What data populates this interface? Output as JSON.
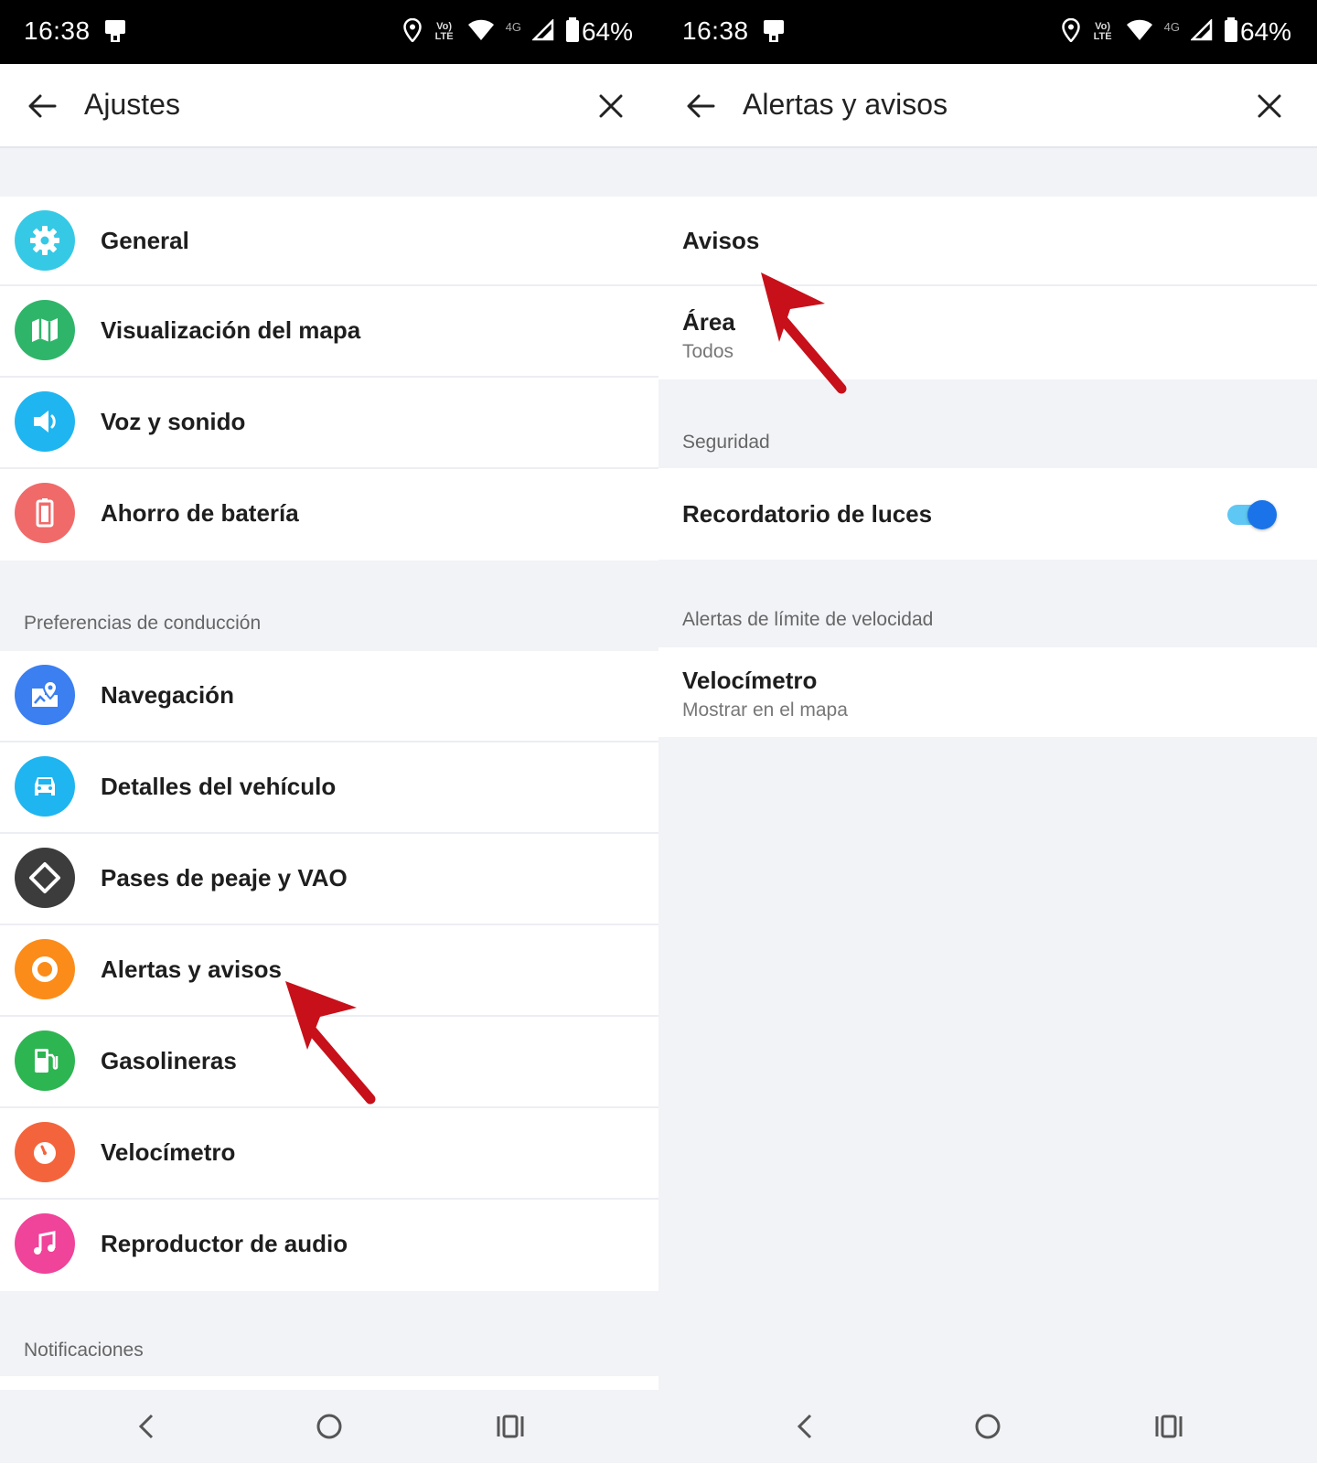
{
  "status_bar": {
    "time": "16:38",
    "volte": "Vo) LTE",
    "network": "4G",
    "battery": "64%"
  },
  "left": {
    "title": "Ajustes",
    "items": [
      {
        "label": "General",
        "icon": "gear-icon",
        "color": "#36c9e6"
      },
      {
        "label": "Visualización del mapa",
        "icon": "map-icon",
        "color": "#2fb56a"
      },
      {
        "label": "Voz y sonido",
        "icon": "speaker-icon",
        "color": "#1fb5f0"
      },
      {
        "label": "Ahorro de batería",
        "icon": "battery-icon",
        "color": "#f06a6a"
      }
    ],
    "section_driving": "Preferencias de conducción",
    "driving_items": [
      {
        "label": "Navegación",
        "icon": "navigation-icon",
        "color": "#3b7ff0"
      },
      {
        "label": "Detalles del vehículo",
        "icon": "car-icon",
        "color": "#1fb5f0"
      },
      {
        "label": "Pases de peaje y VAO",
        "icon": "toll-diamond-icon",
        "color": "#3c3c3c"
      },
      {
        "label": "Alertas y avisos",
        "icon": "alert-icon",
        "color": "#fb8c1a"
      },
      {
        "label": "Gasolineras",
        "icon": "gas-pump-icon",
        "color": "#2db552"
      },
      {
        "label": "Velocímetro",
        "icon": "speedometer-icon",
        "color": "#f4643c"
      },
      {
        "label": "Reproductor de audio",
        "icon": "music-icon",
        "color": "#f0439a"
      }
    ],
    "section_notifications": "Notificaciones"
  },
  "right": {
    "title": "Alertas y avisos",
    "avisos": "Avisos",
    "area": {
      "title": "Área",
      "value": "Todos"
    },
    "section_security": "Seguridad",
    "lights_reminder": {
      "label": "Recordatorio de luces",
      "enabled": true
    },
    "section_speed": "Alertas de límite de velocidad",
    "speedometer": {
      "title": "Velocímetro",
      "value": "Mostrar en el mapa"
    }
  },
  "colors": {
    "accent_blue": "#1a73e8",
    "arrow_red": "#c8101a"
  }
}
